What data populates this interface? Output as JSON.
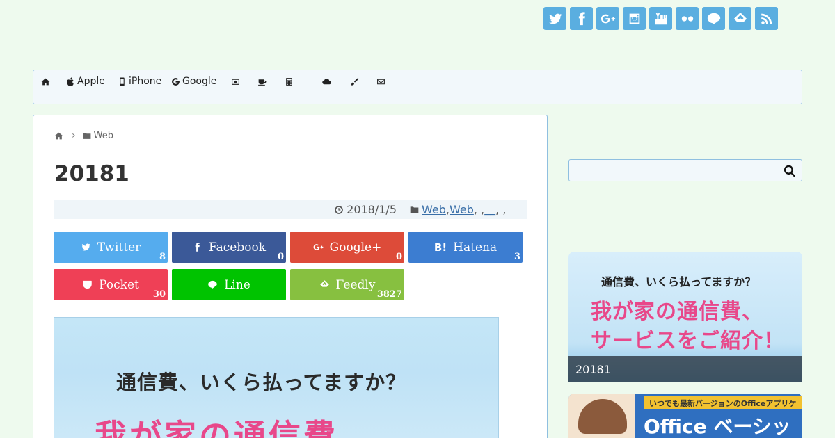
{
  "social_icons": [
    "twitter-icon",
    "facebook-icon",
    "google-plus-icon",
    "instagram-icon",
    "youtube-icon",
    "flickr-icon",
    "line-icon",
    "feedly-icon",
    "rss-icon"
  ],
  "nav": {
    "items": [
      {
        "label": "",
        "icon": "home-icon"
      },
      {
        "label": "Apple",
        "icon": "apple-icon"
      },
      {
        "label": "iPhone",
        "icon": "mobile-icon"
      },
      {
        "label": "Google",
        "icon": "google-icon"
      },
      {
        "label": "",
        "icon": "camera-icon"
      },
      {
        "label": "",
        "icon": "coffee-icon"
      },
      {
        "label": "",
        "icon": "calculator-icon"
      },
      {
        "label": "",
        "icon": "cloud-icon"
      },
      {
        "label": "",
        "icon": "brush-icon"
      },
      {
        "label": "",
        "icon": "envelope-icon"
      }
    ]
  },
  "breadcrumb": {
    "separator": "›",
    "category": "Web"
  },
  "article": {
    "title": "20181",
    "date": "2018/1/5",
    "categories": {
      "cat1": "Web",
      "sep1": ", ",
      "cat2": "Web",
      "rest": ", , ",
      "cat3": "__",
      "tail": ", ,"
    }
  },
  "share_buttons": [
    {
      "label": "Twitter",
      "count": "8",
      "color": "#55acee"
    },
    {
      "label": "Facebook",
      "count": "0",
      "color": "#3b5998"
    },
    {
      "label": "Google+",
      "count": "0",
      "color": "#dd4b39"
    },
    {
      "label": "Hatena",
      "count": "3",
      "color": "#3c7dd1"
    },
    {
      "label": "Pocket",
      "count": "30",
      "color": "#ef4056"
    },
    {
      "label": "Line",
      "count": "",
      "color": "#00c300"
    },
    {
      "label": "Feedly",
      "count": "3827",
      "color": "#87c040"
    }
  ],
  "hero": {
    "line1": "通信費、いくら払ってますか？",
    "line2": "我が家の通信費"
  },
  "sidebar": {
    "search_placeholder": "",
    "card1": {
      "line1": "通信費、いくら払ってますか？",
      "line2": "我が家の通信費、",
      "line3": "サービスをご紹介！",
      "caption": "20181"
    },
    "card2": {
      "banner": "いつでも最新バージョンのOfficeアプリケ",
      "big": "Office ベーシッ"
    }
  },
  "colors": {
    "background": "#eefaee",
    "border": "#8fbfe0",
    "link": "#3a6fa8",
    "pink": "#e8488a"
  }
}
